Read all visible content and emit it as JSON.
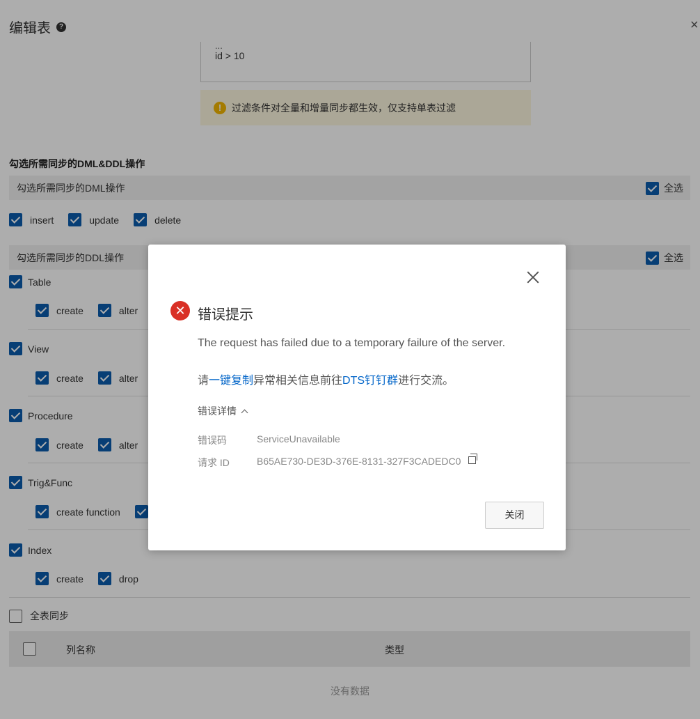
{
  "drawer": {
    "title": "编辑表",
    "help_icon": "?",
    "close_icon": "×"
  },
  "filter": {
    "cut_text": "...",
    "condition": "id > 10",
    "warning": "过滤条件对全量和增量同步都生效，仅支持单表过滤"
  },
  "ops": {
    "title": "勾选所需同步的DML&DDL操作",
    "dml_bar": "勾选所需同步的DML操作",
    "ddl_bar": "勾选所需同步的DDL操作",
    "select_all": "全选",
    "dml_items": [
      "insert",
      "update",
      "delete"
    ],
    "ddl_groups": [
      {
        "name": "Table",
        "items": [
          "create",
          "alter"
        ]
      },
      {
        "name": "View",
        "items": [
          "create",
          "alter"
        ]
      },
      {
        "name": "Procedure",
        "items": [
          "create",
          "alter"
        ]
      },
      {
        "name": "Trig&Func",
        "items": [
          "create function"
        ]
      },
      {
        "name": "Index",
        "items": [
          "create",
          "drop"
        ]
      }
    ]
  },
  "full_sync": {
    "label": "全表同步",
    "checked": false
  },
  "table": {
    "col_name": "列名称",
    "col_type": "类型",
    "empty": "没有数据"
  },
  "dialog": {
    "title": "错误提示",
    "message": "The request has failed due to a temporary failure of the server.",
    "msg_prefix": "请",
    "msg_link1": "一键复制",
    "msg_mid": "异常相关信息前往",
    "msg_link2": "DTS钉钉群",
    "msg_suffix": "进行交流。",
    "details_label": "错误详情",
    "error_code_label": "错误码",
    "error_code": "ServiceUnavailable",
    "request_id_label": "请求 ID",
    "request_id": "B65AE730-DE3D-376E-8131-327F3CADEDC0",
    "close_button": "关闭",
    "colors": {
      "error": "#d93026",
      "link": "#0064c8",
      "checkbox": "#0b5cad"
    }
  }
}
